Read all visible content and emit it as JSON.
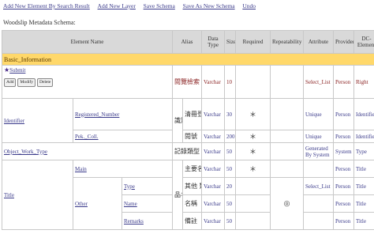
{
  "toolbar": {
    "add_by_search": "Add New Element By Search Result",
    "add_layer": "Add New Layer",
    "save_schema": "Save Schema",
    "save_as": "Save As New Schema",
    "undo": "Undo"
  },
  "schema_title": "Woodslip Metadata Schema:",
  "headers": {
    "element_name": "Element Name",
    "alias": "Alias",
    "data_type": "Data Type",
    "size": "Size",
    "required": "Required",
    "repeatability": "Repeatability",
    "attribute": "Attribute",
    "provider": "Provider",
    "dc_element": "DC-Element"
  },
  "section": "Basic_Information",
  "submit": {
    "star": "★",
    "label": "Submit",
    "btn_add": "Add",
    "btn_modify": "Modify",
    "btn_delete": "Delete",
    "alias": "閱覽檢索",
    "type": "Varchar",
    "size": "10",
    "attribute": "Select_List",
    "provider": "Person",
    "dc": "Right"
  },
  "identifier": {
    "label": "Identifier",
    "group_alias": "識別資料",
    "sub1": {
      "label": "Registered_Number",
      "alias": "清冊登錄號",
      "type": "Varchar",
      "size": "30",
      "required": "＊",
      "attribute": "Unique",
      "provider": "Person",
      "dc": "Identifier"
    },
    "sub2": {
      "label": "Pek._Coll.",
      "alias": "閱號",
      "type": "Varchar",
      "size": "200",
      "required": "＊",
      "attribute": "Unique",
      "provider": "Person",
      "dc": "Identifier"
    }
  },
  "object_work_type": {
    "label": "Object_Work_Type",
    "alias": "記錄類型",
    "type": "Varchar",
    "size": "50",
    "required": "＊",
    "attribute": "Generated By System",
    "provider": "System",
    "dc": "Type"
  },
  "title": {
    "label": "Title",
    "group_alias": "品名",
    "main": {
      "label": "Main",
      "alias": "主要名稱",
      "type": "Varchar",
      "size": "50",
      "required": "＊",
      "provider": "Person",
      "dc": "Title"
    },
    "other": {
      "label": "Other",
      "group_alias": "其他",
      "repeat": "◎",
      "type_row": {
        "label": "Type",
        "alias": "類型",
        "type": "Varchar",
        "size": "20",
        "attribute": "Select_List",
        "provider": "Person",
        "dc": "Title"
      },
      "name_row": {
        "label": "Name",
        "alias": "名稱",
        "type": "Varchar",
        "size": "50",
        "provider": "Person",
        "dc": "Title"
      },
      "remarks_row": {
        "label": "Remarks",
        "alias": "備註",
        "type": "Varchar",
        "size": "50",
        "provider": "Person",
        "dc": "Title"
      }
    }
  }
}
